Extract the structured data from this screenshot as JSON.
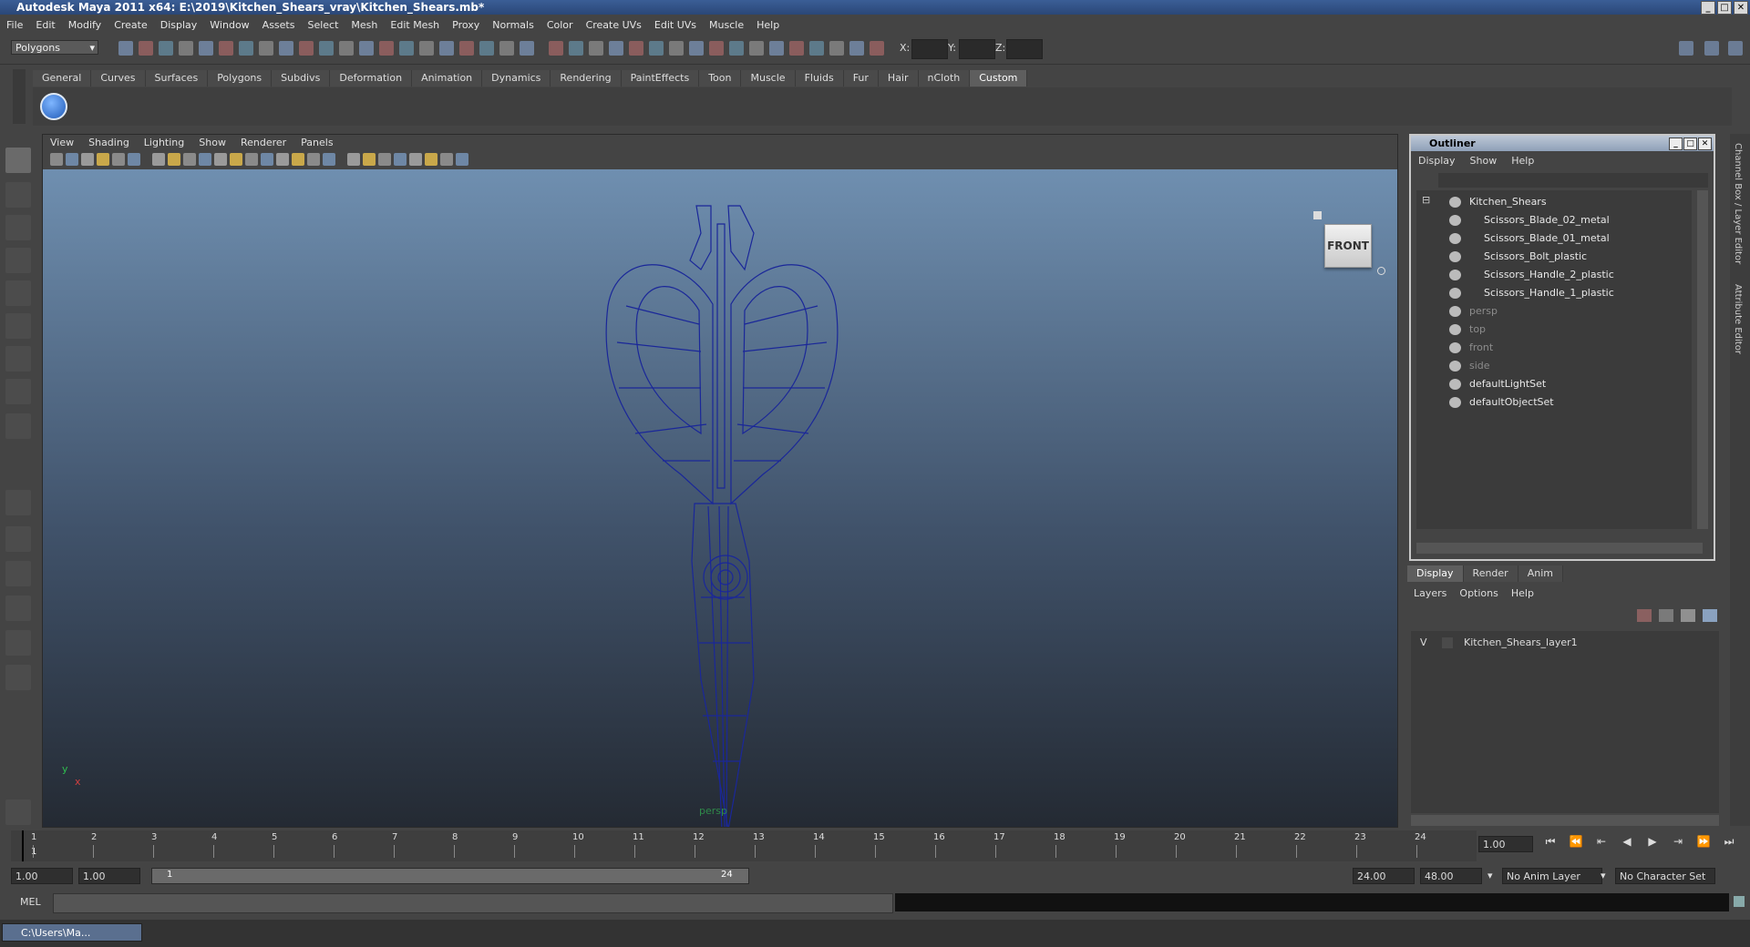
{
  "window": {
    "title": "Autodesk Maya 2011 x64: E:\\2019\\Kitchen_Shears_vray\\Kitchen_Shears.mb*"
  },
  "menubar": [
    "File",
    "Edit",
    "Modify",
    "Create",
    "Display",
    "Window",
    "Assets",
    "Select",
    "Mesh",
    "Edit Mesh",
    "Proxy",
    "Normals",
    "Color",
    "Create UVs",
    "Edit UVs",
    "Muscle",
    "Help"
  ],
  "status": {
    "mode": "Polygons",
    "x_label": "X:",
    "y_label": "Y:",
    "z_label": "Z:"
  },
  "shelf_tabs": [
    "General",
    "Curves",
    "Surfaces",
    "Polygons",
    "Subdivs",
    "Deformation",
    "Animation",
    "Dynamics",
    "Rendering",
    "PaintEffects",
    "Toon",
    "Muscle",
    "Fluids",
    "Fur",
    "Hair",
    "nCloth",
    "Custom"
  ],
  "shelf_active": "Custom",
  "viewport": {
    "menu": [
      "View",
      "Shading",
      "Lighting",
      "Show",
      "Renderer",
      "Panels"
    ],
    "viewcube": "FRONT",
    "camera": "persp",
    "axis_x": "x",
    "axis_y": "y",
    "wire_color": "#1a2799"
  },
  "outliner": {
    "title": "Outliner",
    "menu": [
      "Display",
      "Show",
      "Help"
    ],
    "items": [
      {
        "label": "Kitchen_Shears",
        "indent": 0,
        "dim": false
      },
      {
        "label": "Scissors_Blade_02_metal",
        "indent": 1,
        "dim": false
      },
      {
        "label": "Scissors_Blade_01_metal",
        "indent": 1,
        "dim": false
      },
      {
        "label": "Scissors_Bolt_plastic",
        "indent": 1,
        "dim": false
      },
      {
        "label": "Scissors_Handle_2_plastic",
        "indent": 1,
        "dim": false
      },
      {
        "label": "Scissors_Handle_1_plastic",
        "indent": 1,
        "dim": false
      },
      {
        "label": "persp",
        "indent": 0,
        "dim": true
      },
      {
        "label": "top",
        "indent": 0,
        "dim": true
      },
      {
        "label": "front",
        "indent": 0,
        "dim": true
      },
      {
        "label": "side",
        "indent": 0,
        "dim": true
      },
      {
        "label": "defaultLightSet",
        "indent": 0,
        "dim": false
      },
      {
        "label": "defaultObjectSet",
        "indent": 0,
        "dim": false
      }
    ]
  },
  "layer_editor": {
    "tabs": [
      "Display",
      "Render",
      "Anim"
    ],
    "menu": [
      "Layers",
      "Options",
      "Help"
    ],
    "layer": {
      "visibility": "V",
      "name": "Kitchen_Shears_layer1"
    }
  },
  "side_tabs": [
    "Channel Box / Layer Editor",
    "Attribute Editor"
  ],
  "timeline": {
    "ticks": [
      "1",
      "2",
      "3",
      "4",
      "5",
      "6",
      "7",
      "8",
      "9",
      "10",
      "11",
      "12",
      "13",
      "14",
      "15",
      "16",
      "17",
      "18",
      "19",
      "20",
      "21",
      "22",
      "23",
      "24"
    ],
    "current_frame_label": "1",
    "current_time": "1.00"
  },
  "range": {
    "start": "1.00",
    "playback_start": "1.00",
    "slider_start": "1",
    "slider_end": "24",
    "playback_end": "24.00",
    "end": "48.00",
    "anim_layer": "No Anim Layer",
    "character_set": "No Character Set"
  },
  "command": {
    "label": "MEL"
  },
  "taskbar": {
    "item": "C:\\Users\\Ma..."
  }
}
